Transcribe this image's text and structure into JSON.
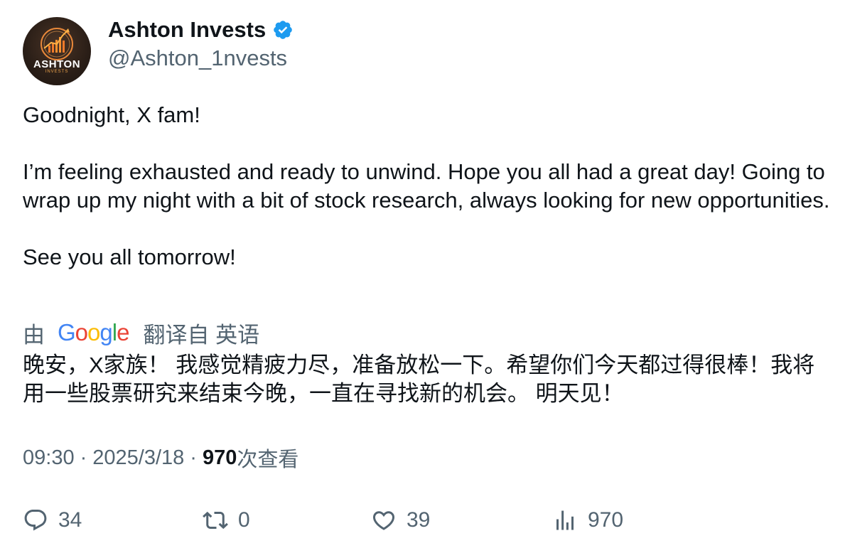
{
  "author": {
    "display_name": "Ashton Invests",
    "handle": "@Ashton_1nvests",
    "avatar_text": "ASHTON",
    "avatar_subtext": "INVESTS",
    "verified_icon": "verified-badge-icon",
    "verified_color": "#1d9bf0"
  },
  "tweet": {
    "line1": "Goodnight, X fam!",
    "line2": "I’m feeling exhausted and ready to unwind. Hope you all had a great day! Going to wrap up my night with a bit of stock research, always looking for new opportunities.",
    "line3": "See you all tomorrow!"
  },
  "translation": {
    "prefix": "由",
    "google_letters": [
      "G",
      "o",
      "o",
      "g",
      "l",
      "e"
    ],
    "google_colors": [
      "#4285f4",
      "#ea4335",
      "#fbbc05",
      "#4285f4",
      "#34a853",
      "#ea4335"
    ],
    "suffix": "翻译自 英语",
    "text": "晚安，X家族！ 我感觉精疲力尽，准备放松一下。希望你们今天都过得很棒！我将用一些股票研究来结束今晚，一直在寻找新的机会。 明天见！"
  },
  "meta": {
    "time": "09:30",
    "separator": "·",
    "date": "2025/3/18",
    "views_count": "970",
    "views_label": "次查看"
  },
  "actions": {
    "replies": "34",
    "reposts": "0",
    "likes": "39",
    "views": "970"
  }
}
